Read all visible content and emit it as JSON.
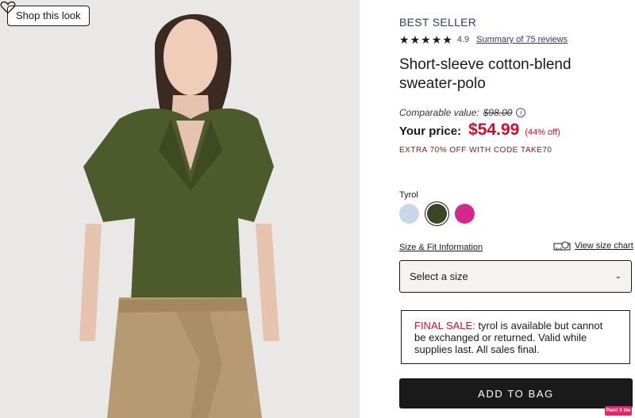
{
  "media": {
    "shop_label": "Shop this look"
  },
  "product": {
    "badge": "BEST SELLER",
    "rating": "4.9",
    "reviews_label": "Summary of 75 reviews",
    "title": "Short-sleeve cotton-blend sweater-polo",
    "comparable_label": "Comparable value:",
    "comparable_price": "$98.00",
    "your_price_label": "Your price:",
    "price": "$54.99",
    "discount": "(44% off)",
    "promo": "EXTRA 70% OFF WITH CODE TAKE70"
  },
  "color": {
    "selected_name": "Tyrol",
    "swatches": [
      {
        "color": "#c8d8e6",
        "selected": false
      },
      {
        "color": "#3b4424",
        "selected": true
      },
      {
        "color": "#d6288a",
        "selected": false
      }
    ]
  },
  "size": {
    "fit_link": "Size & Fit Information",
    "chart_link": "View size chart",
    "select_placeholder": "Select a size"
  },
  "notice": {
    "label": "FINAL SALE:",
    "text": " tyrol is available but cannot be exchanged or returned. Valid while supplies last. All sales final."
  },
  "cta": {
    "add_to_bag": "ADD TO BAG"
  },
  "extension": {
    "badge": "Paint X lite"
  },
  "colors": {
    "accent_red": "#c8102e",
    "link_navy": "#2c3e63",
    "primary_black": "#1a1a1a"
  },
  "icons": [
    "heart-icon",
    "star-icon",
    "info-icon",
    "measuring-tape-icon",
    "chevron-down-icon"
  ]
}
